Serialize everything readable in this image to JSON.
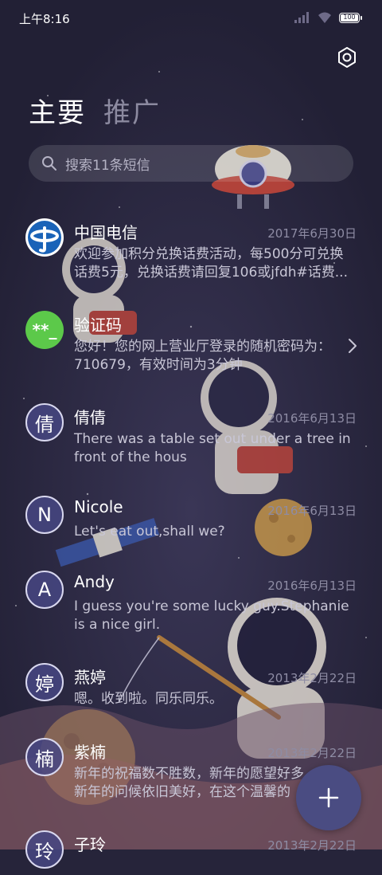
{
  "status": {
    "time": "上午8:16",
    "battery": "100"
  },
  "tabs": [
    {
      "label": "主要",
      "active": true
    },
    {
      "label": "推广",
      "active": false
    }
  ],
  "search": {
    "placeholder": "搜索11条短信"
  },
  "conversations": [
    {
      "avatar_type": "telecom-logo",
      "avatar_text": "",
      "name": "中国电信",
      "date": "2017年6月30日",
      "snippet_lines": [
        "欢迎参加积分兑换话费活动，每500分可兑换",
        "话费5元，兑换话费请回复106或jfdh#话费..."
      ]
    },
    {
      "avatar_type": "green",
      "avatar_text": "**_",
      "name": "验证码",
      "date": "",
      "snippet_lines": [
        "您好！您的网上营业厅登录的随机密码为：",
        "710679，有效时间为3分钟"
      ]
    },
    {
      "avatar_type": "letter",
      "avatar_text": "倩",
      "name": "倩倩",
      "date": "2016年6月13日",
      "snippet_lines": [
        "There was a table set out under a tree in",
        "front of the hous"
      ]
    },
    {
      "avatar_type": "letter",
      "avatar_text": "N",
      "name": "Nicole",
      "date": "2016年6月13日",
      "snippet_lines": [
        "Let's eat out,shall we?",
        ""
      ]
    },
    {
      "avatar_type": "letter",
      "avatar_text": "A",
      "name": "Andy",
      "date": "2016年6月13日",
      "snippet_lines": [
        "I guess you're some lucky guy.Stephanie",
        "is a nice girl."
      ]
    },
    {
      "avatar_type": "letter",
      "avatar_text": "婷",
      "name": "燕婷",
      "date": "2013年2月22日",
      "snippet_lines": [
        "嗯。收到啦。同乐同乐。",
        ""
      ]
    },
    {
      "avatar_type": "letter",
      "avatar_text": "楠",
      "name": "紫楠",
      "date": "2013年2月22日",
      "snippet_lines": [
        "新年的祝福数不胜数，新年的愿望好多",
        "新年的问候依旧美好，在这个温馨的"
      ]
    },
    {
      "avatar_type": "letter",
      "avatar_text": "玲",
      "name": "子玲",
      "date": "2013年2月22日",
      "snippet_lines": [
        "",
        ""
      ]
    }
  ],
  "icons": {
    "settings": "gear-icon",
    "search": "search-icon",
    "chevron": "chevron-right-icon",
    "fab": "plus-icon",
    "signal": "signal-icon",
    "wifi": "wifi-icon",
    "battery": "battery-icon"
  },
  "colors": {
    "background": "#26243a",
    "fab": "#4a4c82",
    "verify_avatar": "#5cc94a",
    "muted_text": "#8e8ca4"
  }
}
